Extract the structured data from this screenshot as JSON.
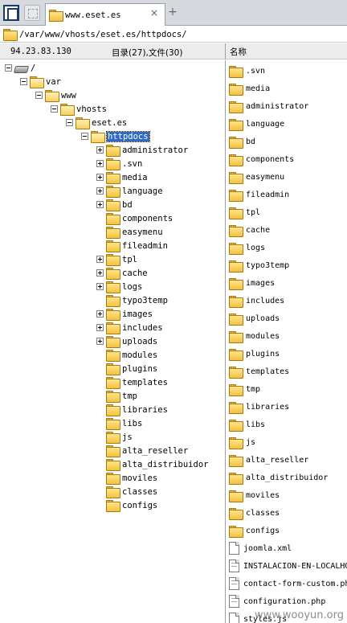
{
  "tab": {
    "title": "www.eset.es",
    "close_glyph": "×",
    "add_glyph": "+"
  },
  "path": {
    "value": "/var/www/vhosts/eset.es/httpdocs/"
  },
  "info": {
    "ip": "94.23.83.130",
    "counts": "目录(27),文件(30)"
  },
  "right_header": {
    "name_col": "名称"
  },
  "tree": {
    "root": "/",
    "ancestors": [
      "var",
      "www",
      "vhosts",
      "eset.es"
    ],
    "selected": "httpdocs",
    "children": [
      {
        "label": "administrator",
        "expandable": true
      },
      {
        "label": ".svn",
        "expandable": true
      },
      {
        "label": "media",
        "expandable": true
      },
      {
        "label": "language",
        "expandable": true
      },
      {
        "label": "bd",
        "expandable": true
      },
      {
        "label": "components",
        "expandable": false
      },
      {
        "label": "easymenu",
        "expandable": false
      },
      {
        "label": "fileadmin",
        "expandable": false
      },
      {
        "label": "tpl",
        "expandable": true
      },
      {
        "label": "cache",
        "expandable": true
      },
      {
        "label": "logs",
        "expandable": true
      },
      {
        "label": "typo3temp",
        "expandable": false
      },
      {
        "label": "images",
        "expandable": true
      },
      {
        "label": "includes",
        "expandable": true
      },
      {
        "label": "uploads",
        "expandable": true
      },
      {
        "label": "modules",
        "expandable": false
      },
      {
        "label": "plugins",
        "expandable": false
      },
      {
        "label": "templates",
        "expandable": false
      },
      {
        "label": "tmp",
        "expandable": false
      },
      {
        "label": "libraries",
        "expandable": false
      },
      {
        "label": "libs",
        "expandable": false
      },
      {
        "label": "js",
        "expandable": false
      },
      {
        "label": "alta_reseller",
        "expandable": false
      },
      {
        "label": "alta_distribuidor",
        "expandable": false
      },
      {
        "label": "moviles",
        "expandable": false
      },
      {
        "label": "classes",
        "expandable": false
      },
      {
        "label": "configs",
        "expandable": false
      }
    ]
  },
  "right_items": [
    {
      "label": ".svn",
      "kind": "folder"
    },
    {
      "label": "media",
      "kind": "folder"
    },
    {
      "label": "administrator",
      "kind": "folder"
    },
    {
      "label": "language",
      "kind": "folder"
    },
    {
      "label": "bd",
      "kind": "folder"
    },
    {
      "label": "components",
      "kind": "folder"
    },
    {
      "label": "easymenu",
      "kind": "folder"
    },
    {
      "label": "fileadmin",
      "kind": "folder"
    },
    {
      "label": "tpl",
      "kind": "folder"
    },
    {
      "label": "cache",
      "kind": "folder"
    },
    {
      "label": "logs",
      "kind": "folder"
    },
    {
      "label": "typo3temp",
      "kind": "folder"
    },
    {
      "label": "images",
      "kind": "folder"
    },
    {
      "label": "includes",
      "kind": "folder"
    },
    {
      "label": "uploads",
      "kind": "folder"
    },
    {
      "label": "modules",
      "kind": "folder"
    },
    {
      "label": "plugins",
      "kind": "folder"
    },
    {
      "label": "templates",
      "kind": "folder"
    },
    {
      "label": "tmp",
      "kind": "folder"
    },
    {
      "label": "libraries",
      "kind": "folder"
    },
    {
      "label": "libs",
      "kind": "folder"
    },
    {
      "label": "js",
      "kind": "folder"
    },
    {
      "label": "alta_reseller",
      "kind": "folder"
    },
    {
      "label": "alta_distribuidor",
      "kind": "folder"
    },
    {
      "label": "moviles",
      "kind": "folder"
    },
    {
      "label": "classes",
      "kind": "folder"
    },
    {
      "label": "configs",
      "kind": "folder"
    },
    {
      "label": "joomla.xml",
      "kind": "file"
    },
    {
      "label": "INSTALACION-EN-LOCALHO",
      "kind": "file-lines"
    },
    {
      "label": "contact-form-custom.ph",
      "kind": "file-lines"
    },
    {
      "label": "configuration.php",
      "kind": "file-lines"
    },
    {
      "label": "styles.js",
      "kind": "file"
    }
  ],
  "watermark": "www.wooyun.org"
}
